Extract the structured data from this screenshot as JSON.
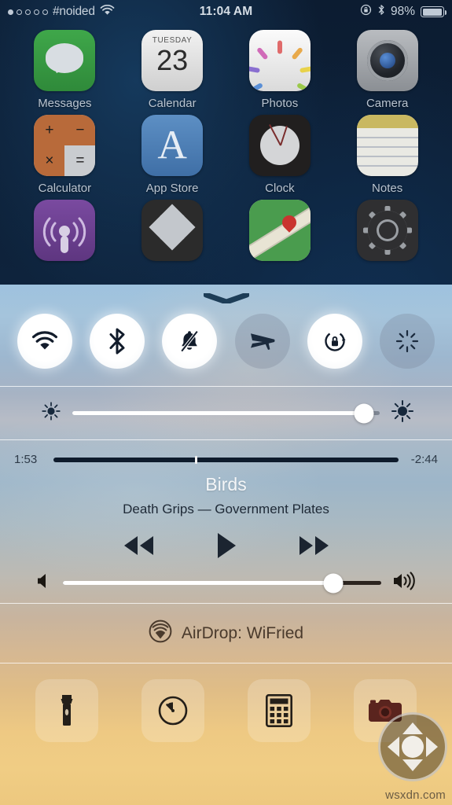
{
  "status_bar": {
    "signal_dots_total": 5,
    "signal_dots_filled": 1,
    "carrier": "#noided",
    "wifi_icon": "wifi-icon",
    "time": "11:04 AM",
    "rotation_lock_icon": "rotation-lock-icon",
    "bluetooth_icon": "bluetooth-icon",
    "battery_percent": "98%",
    "battery_level": 98
  },
  "home_screen": {
    "rows": [
      {
        "apps": [
          {
            "label": "Messages",
            "icon": "messages-icon"
          },
          {
            "label": "Calendar",
            "icon": "calendar-icon",
            "weekday": "TUESDAY",
            "date": "23"
          },
          {
            "label": "Photos",
            "icon": "photos-icon"
          },
          {
            "label": "Camera",
            "icon": "camera-icon"
          }
        ]
      },
      {
        "apps": [
          {
            "label": "Calculator",
            "icon": "calculator-icon",
            "keys": [
              "+",
              "−",
              "×",
              "="
            ]
          },
          {
            "label": "App Store",
            "icon": "app-store-icon",
            "glyph": "A"
          },
          {
            "label": "Clock",
            "icon": "clock-icon"
          },
          {
            "label": "Notes",
            "icon": "notes-icon"
          }
        ]
      },
      {
        "apps": [
          {
            "label": "",
            "icon": "podcasts-icon"
          },
          {
            "label": "",
            "icon": "dropbox-icon"
          },
          {
            "label": "",
            "icon": "maps-icon"
          },
          {
            "label": "",
            "icon": "settings-icon"
          }
        ]
      }
    ]
  },
  "control_center": {
    "grabber_icon": "chevron-down-grabber",
    "toggles": [
      {
        "name": "wifi-toggle",
        "icon": "wifi-icon",
        "state": "on"
      },
      {
        "name": "bluetooth-toggle",
        "icon": "bluetooth-icon",
        "state": "on"
      },
      {
        "name": "do-not-disturb-toggle",
        "icon": "bell-slash-icon",
        "state": "on"
      },
      {
        "name": "airplane-mode-toggle",
        "icon": "airplane-icon",
        "state": "off"
      },
      {
        "name": "rotation-lock-toggle",
        "icon": "rotation-lock-icon",
        "state": "on"
      },
      {
        "name": "night-shift-toggle",
        "icon": "night-shift-icon",
        "state": "off"
      }
    ],
    "brightness": {
      "low_icon": "brightness-low-icon",
      "high_icon": "brightness-high-icon",
      "value": 95
    },
    "music": {
      "elapsed": "1:53",
      "remaining": "-2:44",
      "progress_percent": 41,
      "title": "Birds",
      "subtitle": "Death Grips — Government Plates",
      "controls": [
        {
          "name": "previous-track-button",
          "icon": "rewind-icon"
        },
        {
          "name": "play-button",
          "icon": "play-icon"
        },
        {
          "name": "next-track-button",
          "icon": "fast-forward-icon"
        }
      ],
      "volume": {
        "low_icon": "volume-low-icon",
        "high_icon": "volume-high-icon",
        "value": 85
      }
    },
    "airdrop": {
      "icon": "airdrop-icon",
      "label": "AirDrop: WiFried"
    },
    "shortcuts": [
      {
        "name": "flashlight-button",
        "icon": "flashlight-icon"
      },
      {
        "name": "timer-button",
        "icon": "timer-icon"
      },
      {
        "name": "calculator-button",
        "icon": "calculator-icon"
      },
      {
        "name": "camera-button",
        "icon": "camera-icon"
      }
    ]
  },
  "assistive_touch": {
    "name": "assistive-touch-button",
    "icon": "dpad-icon"
  },
  "watermark": "wsxdn.com"
}
